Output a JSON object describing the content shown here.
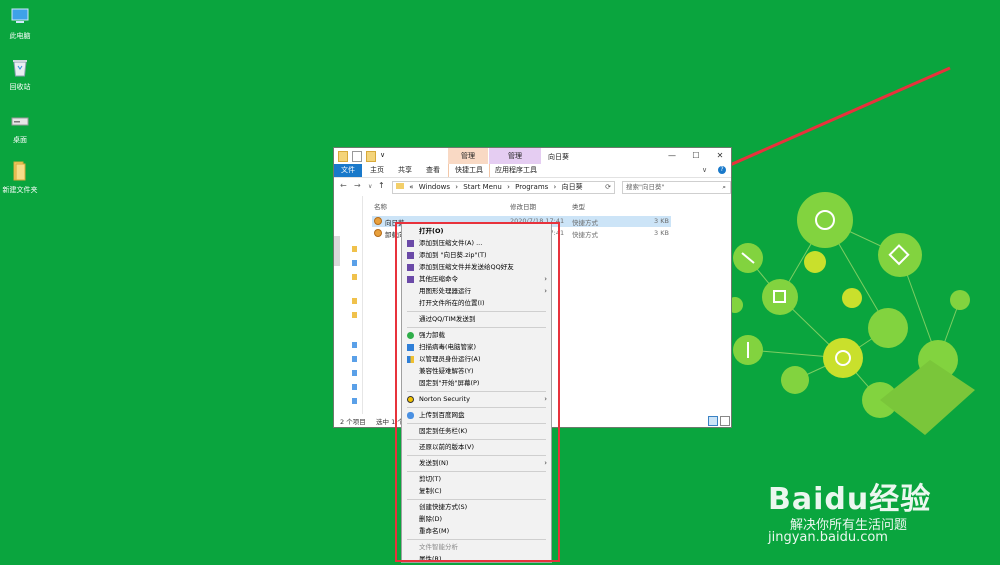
{
  "desktop": {
    "icons": [
      {
        "label": "此电脑",
        "icon": "computer-icon"
      },
      {
        "label": "回收站",
        "icon": "recycle-bin-icon"
      },
      {
        "label": "桌面",
        "icon": "desktop-drive-icon"
      },
      {
        "label": "新建文件夹",
        "icon": "folder-icon"
      }
    ]
  },
  "explorer": {
    "title": "向日葵",
    "context_tabs": [
      "管理",
      "管理"
    ],
    "ribbon_tabs": [
      "文件",
      "主页",
      "共享",
      "查看",
      "快捷工具",
      "应用程序工具"
    ],
    "address": {
      "parts": [
        "«",
        "Windows",
        "›",
        "Start Menu",
        "›",
        "Programs",
        "›",
        "向日葵"
      ]
    },
    "search_placeholder": "搜索\"向日葵\"",
    "columns": {
      "name": "名称",
      "date": "修改日期",
      "type": "类型"
    },
    "files": [
      {
        "name": "向日葵",
        "date": "2020/7/18 17:41",
        "type": "快捷方式",
        "size": "3 KB"
      },
      {
        "name": "卸载向",
        "date": "2020/7/18 17:41",
        "type": "快捷方式",
        "size": "3 KB"
      }
    ],
    "status": {
      "count": "2 个项目",
      "selected": "选中 1 个"
    }
  },
  "context_menu": {
    "items": [
      {
        "label": "打开(O)",
        "bold": true
      },
      {
        "label": "添加到压缩文件(A) ...",
        "icon": "archive-icon"
      },
      {
        "label": "添加到 \"向日葵.zip\"(T)",
        "icon": "archive-icon"
      },
      {
        "label": "添加到压缩文件并发送给QQ好友",
        "icon": "archive-icon"
      },
      {
        "label": "其他压缩命令",
        "icon": "archive-icon",
        "submenu": true
      },
      {
        "label": "用图形处理器运行",
        "submenu": true
      },
      {
        "label": "打开文件所在的位置(I)"
      },
      {
        "label": "通过QQ/TIM发送到"
      },
      {
        "label": "强力卸载",
        "icon": "uninstall-icon"
      },
      {
        "label": "扫描病毒(电脑管家)",
        "icon": "shield-scan-icon"
      },
      {
        "label": "以管理员身份运行(A)",
        "icon": "admin-shield-icon"
      },
      {
        "label": "兼容性疑难解答(Y)"
      },
      {
        "label": "固定到\"开始\"屏幕(P)"
      },
      {
        "label": "Norton Security",
        "icon": "norton-icon",
        "submenu": true
      },
      {
        "label": "上传到百度网盘",
        "icon": "cloud-icon"
      },
      {
        "label": "固定到任务栏(K)"
      },
      {
        "label": "还原以前的版本(V)"
      },
      {
        "label": "发送到(N)",
        "submenu": true
      },
      {
        "label": "剪切(T)"
      },
      {
        "label": "复制(C)"
      },
      {
        "label": "创建快捷方式(S)"
      },
      {
        "label": "删除(D)"
      },
      {
        "label": "重命名(M)"
      },
      {
        "label": "文件智能分析",
        "disabled": true
      },
      {
        "label": "属性(R)"
      }
    ]
  },
  "watermark": {
    "logo": "Baidu经验",
    "slogan": "解决你所有生活问题",
    "url": "jingyan.baidu.com"
  },
  "colors": {
    "desktop": "#0aa53e",
    "highlight_frame": "#e8323c",
    "manage_tab_1": "#f9d9c4",
    "manage_tab_2": "#e5cdf2",
    "file_tab": "#1979ca"
  }
}
